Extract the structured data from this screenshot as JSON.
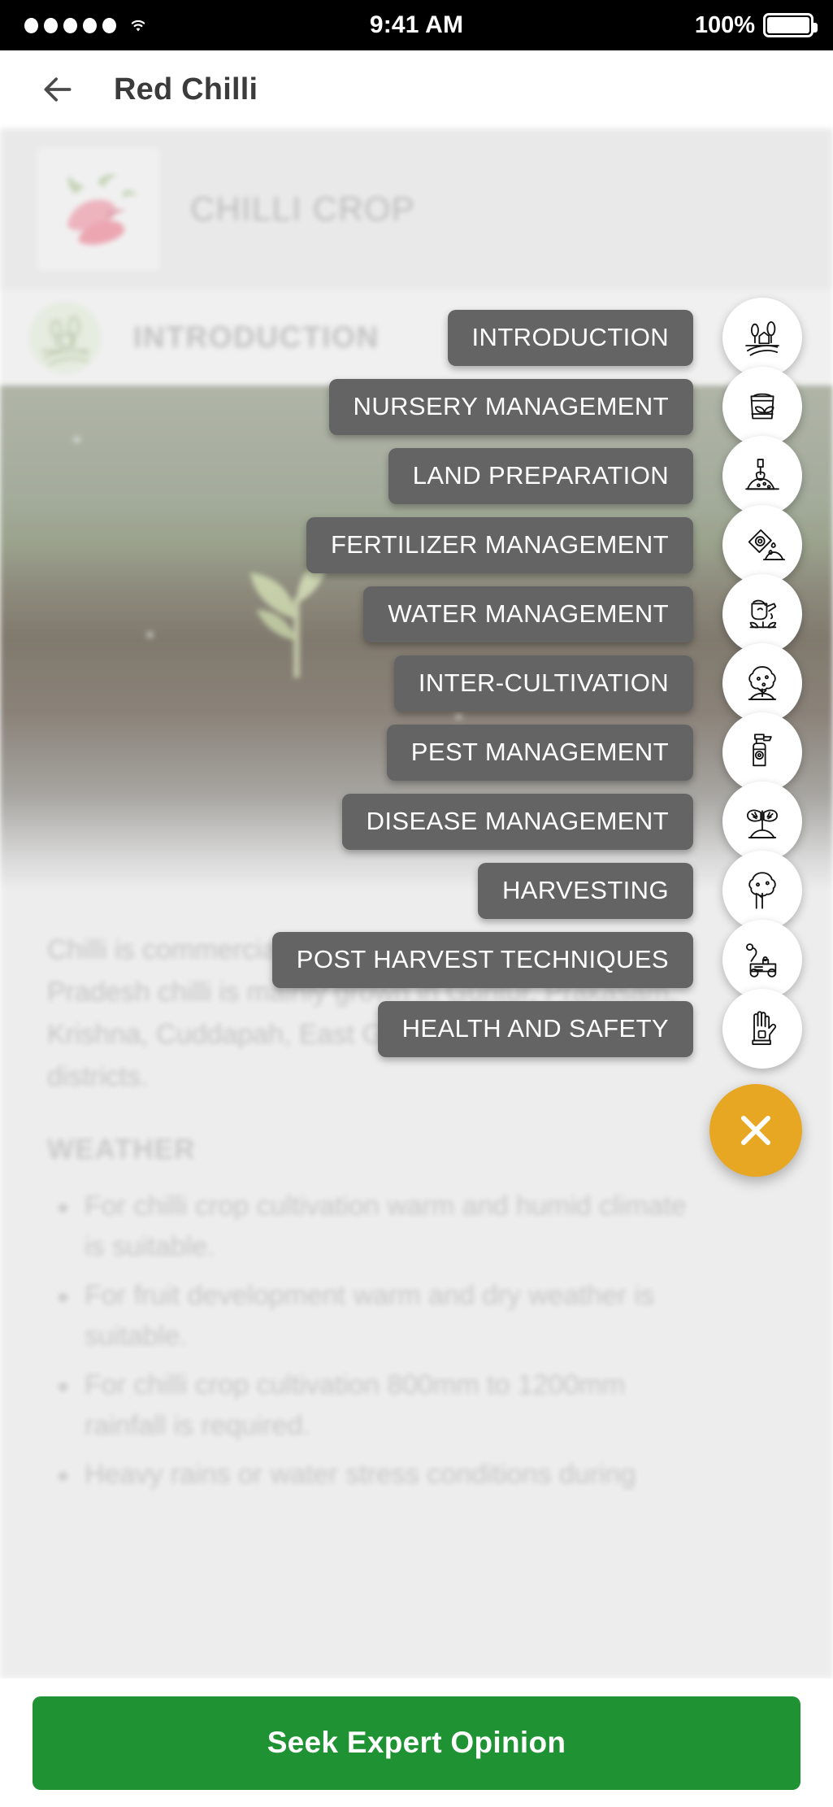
{
  "status_bar": {
    "time": "9:41 AM",
    "battery_percent": "100%",
    "signal_dots": 5,
    "wifi_icon": "wifi-icon",
    "battery_icon": "battery-full-icon"
  },
  "header": {
    "back_icon": "back-arrow-icon",
    "title": "Red Chilli"
  },
  "crop_card": {
    "thumb_icon": "chilli-image",
    "title": "CHILLI CROP"
  },
  "section": {
    "avatar_icon": "farm-field-icon",
    "title": "INTRODUCTION",
    "collapse_icon": "chevron-up-icon"
  },
  "content": {
    "paragraph": "Chilli is commercially cultivated crop. In Andhra Pradesh chilli is mainly grown in Guntur, Prakasam, Krishna, Cuddapah, East Godavari and Nellore districts.",
    "weather_heading": "WEATHER",
    "weather_bullets": [
      "For chilli crop cultivation warm and humid climate is suitable.",
      "For fruit development warm and dry weather is suitable.",
      "For chilli crop cultivation 800mm to 1200mm rainfall is required.",
      "Heavy rains or water stress conditions during"
    ]
  },
  "speed_dial": {
    "close_label": "close-icon",
    "accent_color": "#e8a723",
    "chip_color": "#646464",
    "items": [
      {
        "label": "INTRODUCTION",
        "icon": "farm-field-icon"
      },
      {
        "label": "NURSERY MANAGEMENT",
        "icon": "seed-bag-icon"
      },
      {
        "label": "LAND PREPARATION",
        "icon": "shovel-soil-icon"
      },
      {
        "label": "FERTILIZER MANAGEMENT",
        "icon": "fertilizer-packet-icon"
      },
      {
        "label": "WATER MANAGEMENT",
        "icon": "watering-can-icon"
      },
      {
        "label": "INTER-CULTIVATION",
        "icon": "tree-mound-icon"
      },
      {
        "label": "PEST MANAGEMENT",
        "icon": "spray-bottle-icon"
      },
      {
        "label": "DISEASE MANAGEMENT",
        "icon": "diseased-plant-icon"
      },
      {
        "label": "HARVESTING",
        "icon": "tree-icon"
      },
      {
        "label": "POST HARVEST TECHNIQUES",
        "icon": "mower-machine-icon"
      },
      {
        "label": "HEALTH AND SAFETY",
        "icon": "safety-glove-icon"
      }
    ]
  },
  "cta": {
    "label": "Seek Expert Opinion",
    "color": "#1f9234"
  }
}
